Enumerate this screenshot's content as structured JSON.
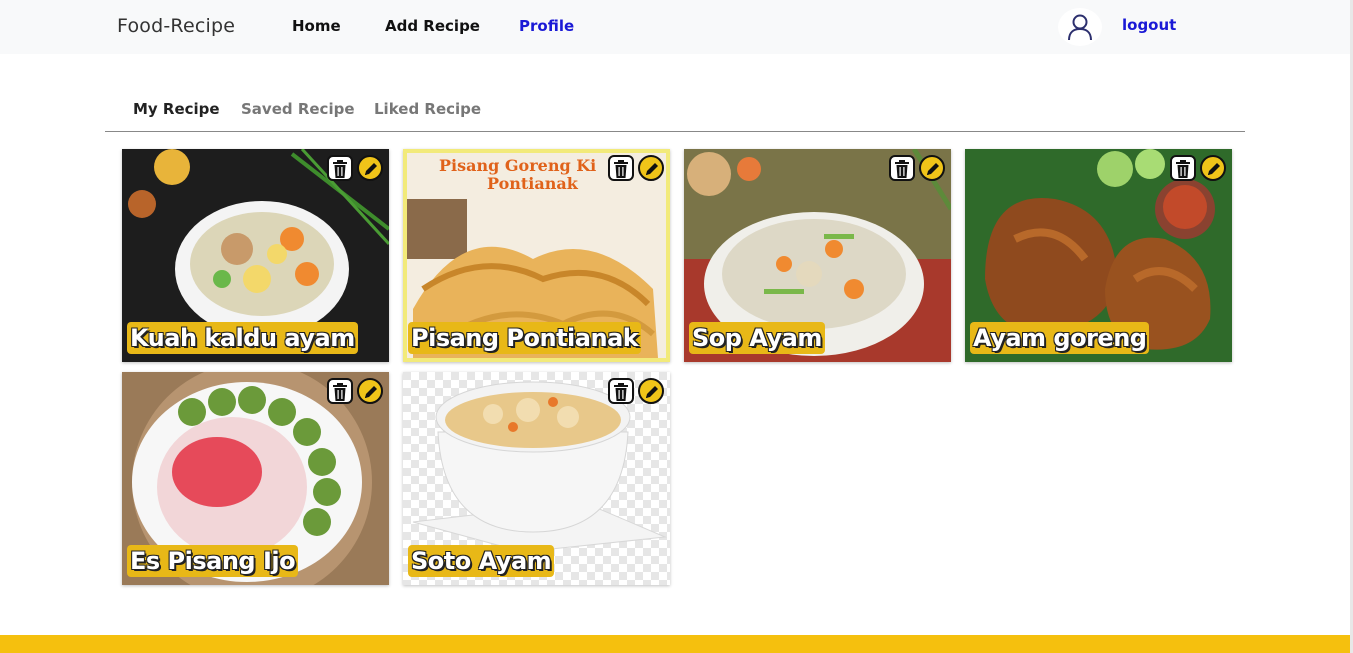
{
  "navbar": {
    "brand": "Food-Recipe",
    "links": {
      "home": "Home",
      "add": "Add Recipe",
      "profile": "Profile"
    },
    "logout": "logout",
    "accent_color": "#1a19d6"
  },
  "tabs": {
    "my": "My Recipe",
    "saved": "Saved Recipe",
    "liked": "Liked Recipe"
  },
  "recipes": [
    {
      "title": "Kuah kaldu ayam"
    },
    {
      "title": "Pisang Pontianak"
    },
    {
      "title": "Sop Ayam"
    },
    {
      "title": "Ayam goreng"
    },
    {
      "title": "Es Pisang Ijo"
    },
    {
      "title": "Soto Ayam"
    }
  ],
  "card_image_lettering": [
    "Pisang Goreng Ki",
    "Pontianak"
  ],
  "icons": {
    "delete": "trash-icon",
    "edit": "pencil-icon",
    "avatar": "user-icon"
  },
  "colors": {
    "title_badge": "#e8b817",
    "footer": "#f5c00e",
    "edit_button": "#f0c419"
  }
}
